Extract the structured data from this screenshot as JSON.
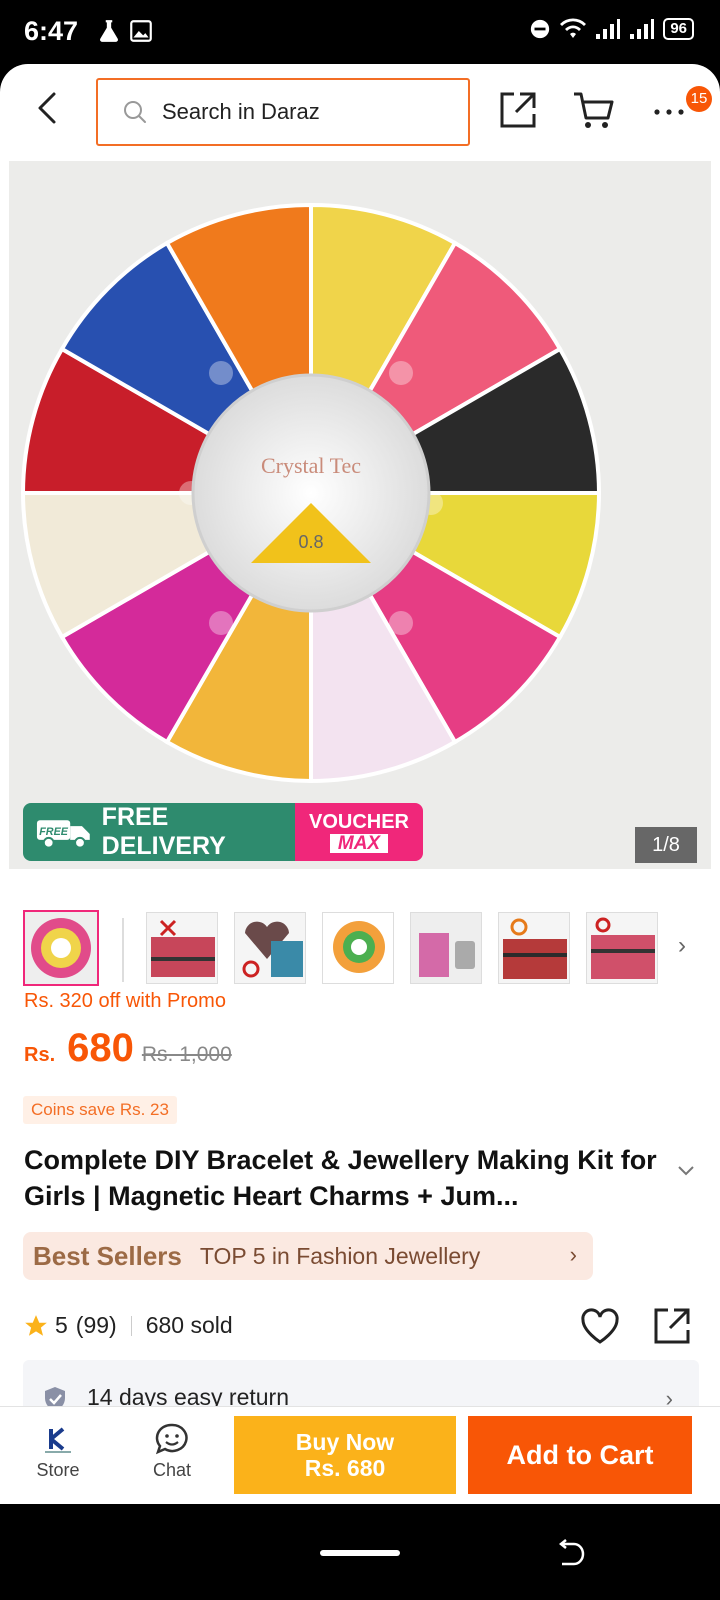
{
  "status": {
    "time": "6:47",
    "battery": "96"
  },
  "header": {
    "search_placeholder": "Search in Daraz",
    "cart_badge": "15"
  },
  "hero": {
    "banner_free": "FREE DELIVERY",
    "banner_free_tag": "FREE",
    "banner_voucher": "VOUCHER",
    "banner_max": "MAX",
    "counter": "1/8",
    "center_brand": "Crystal Tec",
    "center_size": "0.8"
  },
  "pricing": {
    "promo": "Rs. 320 off with Promo",
    "currency": "Rs.",
    "price": "680",
    "old_price": "Rs. 1,000",
    "coins": "Coins save Rs. 23"
  },
  "product": {
    "title": "Complete DIY Bracelet & Jewellery Making Kit for Girls | Magnetic Heart Charms + Jum..."
  },
  "bestseller": {
    "logo": "Best Sellers",
    "text": "TOP 5 in Fashion Jewellery"
  },
  "rating": {
    "score": "5",
    "count": "(99)",
    "sold": "680 sold"
  },
  "returns": {
    "text": "14 days easy return"
  },
  "bottom": {
    "store": "Store",
    "chat": "Chat",
    "buy_now": "Buy Now",
    "buy_price": "Rs. 680",
    "add_to_cart": "Add to Cart"
  },
  "colors": {
    "accent": "#f85606",
    "buy_now": "#fbb21a",
    "delivery_green": "#2e8b6e",
    "voucher_pink": "#f0277a"
  }
}
